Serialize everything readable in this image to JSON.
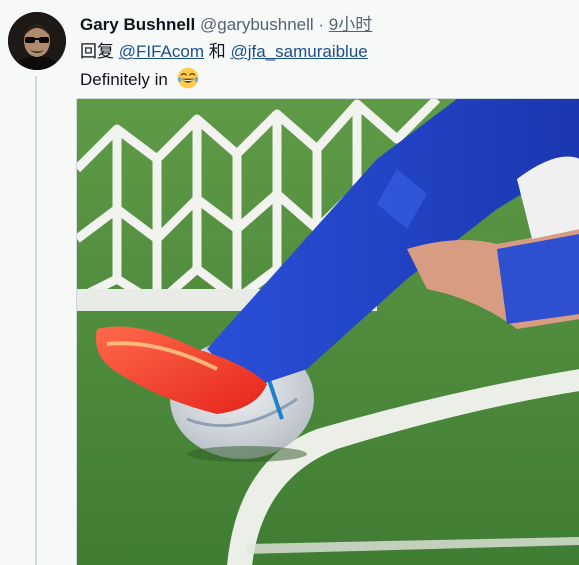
{
  "tweet": {
    "display_name": "Gary Bushnell",
    "handle": "@garybushnell",
    "separator": "·",
    "time": "9小时",
    "reply_prefix": "回复",
    "mentions": [
      "@FIFAcom",
      "@jfa_samuraiblue"
    ],
    "mention_joiner": "和",
    "text": "Definitely in",
    "emoji": "face-with-tears-of-joy"
  },
  "colors": {
    "link": "#1b4f8a",
    "secondary_text": "#536471",
    "thread_line": "#cfd9de",
    "background": "#f7f9f9"
  },
  "media": {
    "type": "photo",
    "subject": "soccer-ball-on-goal-line"
  }
}
